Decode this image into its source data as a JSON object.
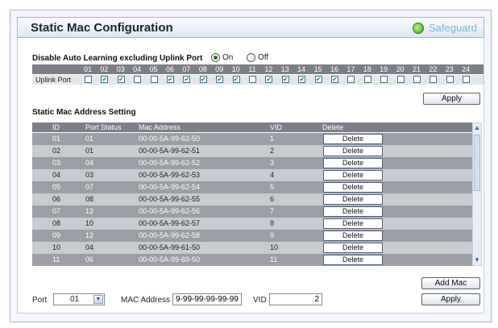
{
  "header": {
    "title": "Static Mac Configuration",
    "brand": "Safeguard"
  },
  "auto_learning": {
    "label": "Disable Auto Learning excluding Uplink Port",
    "on_label": "On",
    "off_label": "Off",
    "selected": "On"
  },
  "ports": {
    "row_label": "Uplink Port",
    "numbers": [
      "01",
      "02",
      "03",
      "04",
      "05",
      "06",
      "07",
      "08",
      "09",
      "10",
      "11",
      "12",
      "13",
      "14",
      "15",
      "16",
      "17",
      "18",
      "19",
      "20",
      "21",
      "22",
      "23",
      "24"
    ],
    "checked": [
      false,
      true,
      true,
      false,
      false,
      true,
      true,
      true,
      true,
      true,
      false,
      true,
      true,
      true,
      true,
      true,
      false,
      false,
      false,
      false,
      false,
      false,
      false,
      false
    ]
  },
  "apply_top_label": "Apply",
  "mac_setting": {
    "title": "Static Mac Address Setting",
    "columns": [
      "ID",
      "Port Status",
      "Mac Address",
      "VID",
      "Delete"
    ],
    "delete_label": "Delete",
    "rows": [
      {
        "id": "01",
        "port": "01",
        "mac": "00-00-5A-99-62-50",
        "vid": "1"
      },
      {
        "id": "02",
        "port": "01",
        "mac": "00-00-5A-99-62-51",
        "vid": "2"
      },
      {
        "id": "03",
        "port": "04",
        "mac": "00-00-5A-99-62-52",
        "vid": "3"
      },
      {
        "id": "04",
        "port": "03",
        "mac": "00-00-5A-99-62-53",
        "vid": "4"
      },
      {
        "id": "05",
        "port": "07",
        "mac": "00-00-5A-99-62-54",
        "vid": "5"
      },
      {
        "id": "06",
        "port": "08",
        "mac": "00-00-5A-99-62-55",
        "vid": "6"
      },
      {
        "id": "07",
        "port": "12",
        "mac": "00-00-5A-99-62-56",
        "vid": "7"
      },
      {
        "id": "08",
        "port": "10",
        "mac": "00-00-5A-99-62-57",
        "vid": "8"
      },
      {
        "id": "09",
        "port": "12",
        "mac": "00-00-5A-99-62-58",
        "vid": "9"
      },
      {
        "id": "10",
        "port": "04",
        "mac": "00-00-5A-99-61-50",
        "vid": "10"
      },
      {
        "id": "11",
        "port": "06",
        "mac": "00-00-5A-99-69-50",
        "vid": "11"
      }
    ]
  },
  "add_mac_label": "Add Mac",
  "form": {
    "port_label": "Port",
    "port_value": "01",
    "mac_label": "MAC Address",
    "mac_value": "9-99-99-99-99-99",
    "vid_label": "VID",
    "vid_value": "2"
  },
  "apply_bottom_label": "Apply",
  "colors": {
    "accent": "#3e9a17",
    "header_bg": "#dfe7f3",
    "table_header": "#7b7f86"
  }
}
